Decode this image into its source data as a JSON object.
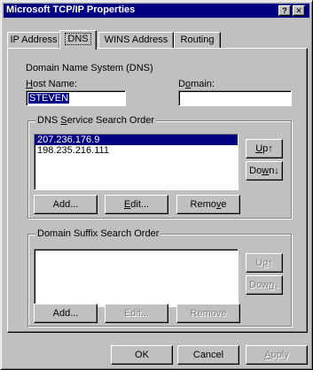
{
  "window": {
    "title": "Microsoft TCP/IP Properties",
    "help_glyph": "?",
    "close_glyph": "✕"
  },
  "tabs": [
    {
      "label": "IP Address"
    },
    {
      "label": "DNS"
    },
    {
      "label": "WINS Address"
    },
    {
      "label": "Routing"
    }
  ],
  "dns": {
    "section_label": "Domain Name System (DNS)",
    "host_label_pre": "",
    "host_label_key": "H",
    "host_label_post": "ost Name:",
    "host_value": "STEVEN",
    "domain_label_pre": "D",
    "domain_label_key": "o",
    "domain_label_post": "main:",
    "domain_value": ""
  },
  "service_group": {
    "legend_pre": "DNS ",
    "legend_key": "S",
    "legend_post": "ervice Search Order",
    "servers": [
      "207.236.176.9",
      "198.235.216.111"
    ],
    "selected_index": 0,
    "up_label_pre": "",
    "up_label_key": "U",
    "up_label_post": "p↑",
    "down_label_pre": "Do",
    "down_label_key": "w",
    "down_label_post": "n↓",
    "add_label_pre": "",
    "add_label_key": "",
    "add_label_post": "Add...",
    "edit_label_pre": "",
    "edit_label_key": "E",
    "edit_label_post": "dit...",
    "remove_label_pre": "Remo",
    "remove_label_key": "v",
    "remove_label_post": "e"
  },
  "suffix_group": {
    "legend_pre": "Domain Suffix Search Order",
    "up_label_pre": "U",
    "up_label_key": "p",
    "up_label_post": "↑",
    "down_label_pre": "Dow",
    "down_label_key": "n",
    "down_label_post": "↓",
    "add_label_pre": "Add...",
    "edit_label_pre": "Edit...",
    "remove_label_pre": "Remove"
  },
  "footer": {
    "ok_label": "OK",
    "cancel_label": "Cancel",
    "apply_label_pre": "",
    "apply_label_key": "A",
    "apply_label_post": "pply"
  }
}
